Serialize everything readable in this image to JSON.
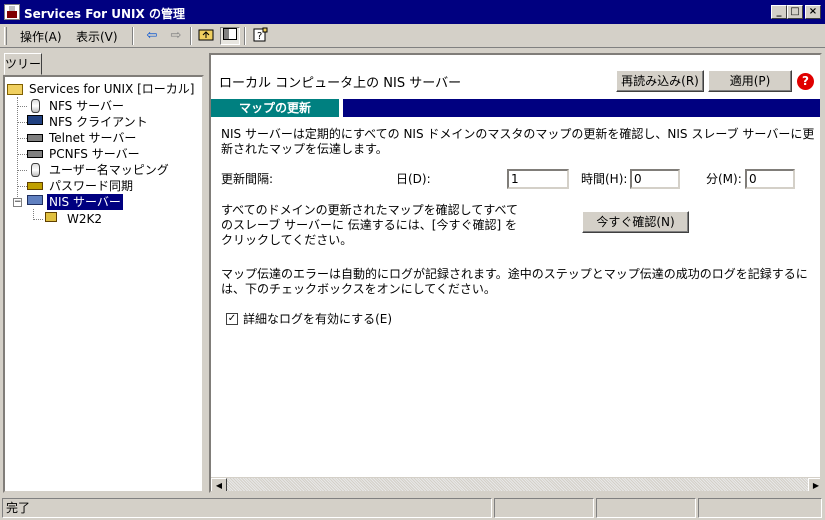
{
  "window": {
    "title": "Services For UNIX の管理"
  },
  "menu": {
    "action": "操作(A)",
    "view": "表示(V)"
  },
  "toolbar": {
    "icons": [
      "back-arrow-icon",
      "forward-arrow-icon",
      "up-folder-icon",
      "show-hide-tree-icon",
      "help-book-icon"
    ]
  },
  "tree": {
    "tab_label": "ツリー",
    "root": "Services for UNIX [ローカル]",
    "items": [
      {
        "label": "NFS サーバー",
        "icon": "database-icon"
      },
      {
        "label": "NFS クライアント",
        "icon": "computer-icon"
      },
      {
        "label": "Telnet サーバー",
        "icon": "network-icon"
      },
      {
        "label": "PCNFS サーバー",
        "icon": "network-icon"
      },
      {
        "label": "ユーザー名マッピング",
        "icon": "database-icon"
      },
      {
        "label": "パスワード同期",
        "icon": "key-icon"
      },
      {
        "label": "NIS サーバー",
        "icon": "nis-icon"
      }
    ],
    "child": "W2K2"
  },
  "panel": {
    "title": "ローカル コンピュータ上の NIS サーバー",
    "reload_label": "再読み込み(R)",
    "apply_label": "適用(P)",
    "section_tab": "マップの更新",
    "description": "NIS サーバーは定期的にすべての NIS ドメインのマスタのマップの更新を確認し、NIS スレーブ サーバーに更新されたマップを伝達します。",
    "interval_label": "更新間隔:",
    "days_label": "日(D):",
    "days_value": "1",
    "hours_label": "時間(H):",
    "hours_value": "0",
    "minutes_label": "分(M):",
    "minutes_value": "0",
    "confirm_text": "すべてのドメインの更新されたマップを確認してすべてのスレーブ サーバーに 伝達するには、[今すぐ確認] をクリックしてください。",
    "confirm_button": "今すぐ確認(N)",
    "log_text": "マップ伝達のエラーは自動的にログが記録されます。途中のステップとマップ伝達の成功のログを記録するには、下のチェックボックスをオンにしてください。",
    "verbose_label": "詳細なログを有効にする(E)",
    "verbose_checked": true
  },
  "status": {
    "text": "完了"
  }
}
